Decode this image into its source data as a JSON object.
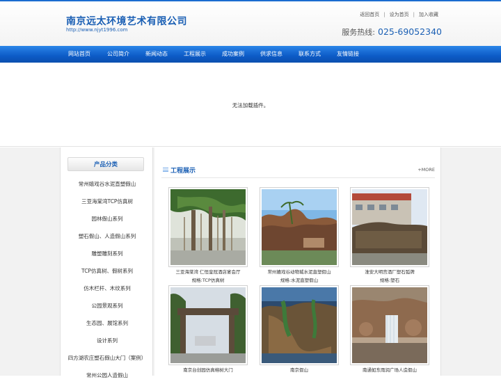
{
  "header": {
    "company": "南京远太环境艺术有限公司",
    "url": "http://www.njyt1996.com",
    "links": [
      "返回首页",
      "设为首页",
      "加入收藏"
    ],
    "hotline_label": "服务热线:",
    "hotline_number": "025-69052340"
  },
  "nav": [
    "网站首页",
    "公司简介",
    "新闻动态",
    "工程展示",
    "成功案例",
    "供求信息",
    "联系方式",
    "友情链接"
  ],
  "banner": {
    "message": "无法加载插件。"
  },
  "sidebar": {
    "title": "产品分类",
    "items": [
      "常州嬉戏谷水泥直塑假山",
      "三亚海棠湾TCP仿真树",
      "园林假山系列",
      "塑石假山、人造假山系列",
      "雕塑雕刻系列",
      "TCP仿真树、假树系列",
      "仿木栏杆、木纹系列",
      "公园景观系列",
      "生态园、展馆系列",
      "设计系列",
      "四方湖农庄塑石假山大门（案例）",
      "常州公园人造假山"
    ]
  },
  "main": {
    "title": "工程展示",
    "more": "+MORE",
    "cards": [
      {
        "caption1": "三亚海棠湾 仁恒皇冠酒店宴会厅",
        "caption2": "规格:TCP仿真树"
      },
      {
        "caption1": "常州嬉戏谷动物城水泥直塑假山",
        "caption2": "规格:水泥直塑假山"
      },
      {
        "caption1": "淮安大明宫酒厂塑石弧牌",
        "caption2": "规格:塑石"
      },
      {
        "caption1": "南京台创园仿真榕树大门",
        "caption2": ""
      },
      {
        "caption1": "南京假山",
        "caption2": ""
      },
      {
        "caption1": "南通如东雨润广场人造假山",
        "caption2": ""
      }
    ]
  },
  "colors": {
    "brand": "#1a5fb4",
    "nav": "#0d5bc7"
  }
}
